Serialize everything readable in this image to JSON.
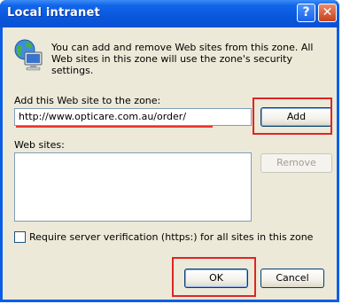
{
  "window": {
    "title": "Local intranet",
    "help_label": "?",
    "close_label": "✕"
  },
  "icon": "sites-globe-computer-icon",
  "info_text": "You can add and remove Web sites from this zone. All Web sites in this zone will use the zone's security settings.",
  "add_site": {
    "label": "Add this Web site to the zone:",
    "value": "http://www.opticare.com.au/order/",
    "add_button": "Add"
  },
  "web_sites": {
    "label": "Web sites:",
    "items": [],
    "remove_button": "Remove"
  },
  "require_verification": {
    "label": "Require server verification (https:) for all sites in this zone",
    "checked": false
  },
  "footer": {
    "ok_button": "OK",
    "cancel_button": "Cancel"
  },
  "colors": {
    "titlebar": "#0a57dc",
    "dialog_bg": "#ece9d8",
    "highlight": "#e02424"
  }
}
